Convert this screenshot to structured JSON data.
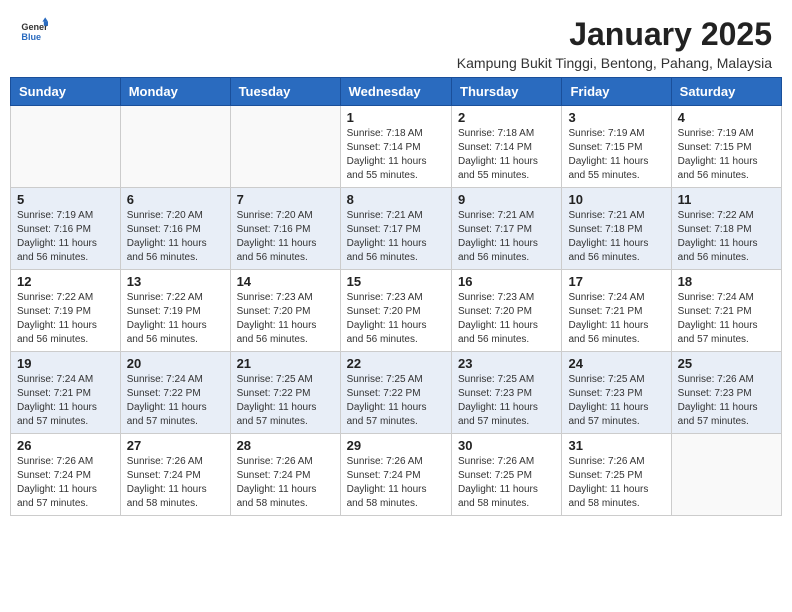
{
  "header": {
    "logo_general": "General",
    "logo_blue": "Blue",
    "month_year": "January 2025",
    "location": "Kampung Bukit Tinggi, Bentong, Pahang, Malaysia"
  },
  "days_of_week": [
    "Sunday",
    "Monday",
    "Tuesday",
    "Wednesday",
    "Thursday",
    "Friday",
    "Saturday"
  ],
  "weeks": [
    [
      {
        "day": "",
        "info": ""
      },
      {
        "day": "",
        "info": ""
      },
      {
        "day": "",
        "info": ""
      },
      {
        "day": "1",
        "info": "Sunrise: 7:18 AM\nSunset: 7:14 PM\nDaylight: 11 hours\nand 55 minutes."
      },
      {
        "day": "2",
        "info": "Sunrise: 7:18 AM\nSunset: 7:14 PM\nDaylight: 11 hours\nand 55 minutes."
      },
      {
        "day": "3",
        "info": "Sunrise: 7:19 AM\nSunset: 7:15 PM\nDaylight: 11 hours\nand 55 minutes."
      },
      {
        "day": "4",
        "info": "Sunrise: 7:19 AM\nSunset: 7:15 PM\nDaylight: 11 hours\nand 56 minutes."
      }
    ],
    [
      {
        "day": "5",
        "info": "Sunrise: 7:19 AM\nSunset: 7:16 PM\nDaylight: 11 hours\nand 56 minutes."
      },
      {
        "day": "6",
        "info": "Sunrise: 7:20 AM\nSunset: 7:16 PM\nDaylight: 11 hours\nand 56 minutes."
      },
      {
        "day": "7",
        "info": "Sunrise: 7:20 AM\nSunset: 7:16 PM\nDaylight: 11 hours\nand 56 minutes."
      },
      {
        "day": "8",
        "info": "Sunrise: 7:21 AM\nSunset: 7:17 PM\nDaylight: 11 hours\nand 56 minutes."
      },
      {
        "day": "9",
        "info": "Sunrise: 7:21 AM\nSunset: 7:17 PM\nDaylight: 11 hours\nand 56 minutes."
      },
      {
        "day": "10",
        "info": "Sunrise: 7:21 AM\nSunset: 7:18 PM\nDaylight: 11 hours\nand 56 minutes."
      },
      {
        "day": "11",
        "info": "Sunrise: 7:22 AM\nSunset: 7:18 PM\nDaylight: 11 hours\nand 56 minutes."
      }
    ],
    [
      {
        "day": "12",
        "info": "Sunrise: 7:22 AM\nSunset: 7:19 PM\nDaylight: 11 hours\nand 56 minutes."
      },
      {
        "day": "13",
        "info": "Sunrise: 7:22 AM\nSunset: 7:19 PM\nDaylight: 11 hours\nand 56 minutes."
      },
      {
        "day": "14",
        "info": "Sunrise: 7:23 AM\nSunset: 7:20 PM\nDaylight: 11 hours\nand 56 minutes."
      },
      {
        "day": "15",
        "info": "Sunrise: 7:23 AM\nSunset: 7:20 PM\nDaylight: 11 hours\nand 56 minutes."
      },
      {
        "day": "16",
        "info": "Sunrise: 7:23 AM\nSunset: 7:20 PM\nDaylight: 11 hours\nand 56 minutes."
      },
      {
        "day": "17",
        "info": "Sunrise: 7:24 AM\nSunset: 7:21 PM\nDaylight: 11 hours\nand 56 minutes."
      },
      {
        "day": "18",
        "info": "Sunrise: 7:24 AM\nSunset: 7:21 PM\nDaylight: 11 hours\nand 57 minutes."
      }
    ],
    [
      {
        "day": "19",
        "info": "Sunrise: 7:24 AM\nSunset: 7:21 PM\nDaylight: 11 hours\nand 57 minutes."
      },
      {
        "day": "20",
        "info": "Sunrise: 7:24 AM\nSunset: 7:22 PM\nDaylight: 11 hours\nand 57 minutes."
      },
      {
        "day": "21",
        "info": "Sunrise: 7:25 AM\nSunset: 7:22 PM\nDaylight: 11 hours\nand 57 minutes."
      },
      {
        "day": "22",
        "info": "Sunrise: 7:25 AM\nSunset: 7:22 PM\nDaylight: 11 hours\nand 57 minutes."
      },
      {
        "day": "23",
        "info": "Sunrise: 7:25 AM\nSunset: 7:23 PM\nDaylight: 11 hours\nand 57 minutes."
      },
      {
        "day": "24",
        "info": "Sunrise: 7:25 AM\nSunset: 7:23 PM\nDaylight: 11 hours\nand 57 minutes."
      },
      {
        "day": "25",
        "info": "Sunrise: 7:26 AM\nSunset: 7:23 PM\nDaylight: 11 hours\nand 57 minutes."
      }
    ],
    [
      {
        "day": "26",
        "info": "Sunrise: 7:26 AM\nSunset: 7:24 PM\nDaylight: 11 hours\nand 57 minutes."
      },
      {
        "day": "27",
        "info": "Sunrise: 7:26 AM\nSunset: 7:24 PM\nDaylight: 11 hours\nand 58 minutes."
      },
      {
        "day": "28",
        "info": "Sunrise: 7:26 AM\nSunset: 7:24 PM\nDaylight: 11 hours\nand 58 minutes."
      },
      {
        "day": "29",
        "info": "Sunrise: 7:26 AM\nSunset: 7:24 PM\nDaylight: 11 hours\nand 58 minutes."
      },
      {
        "day": "30",
        "info": "Sunrise: 7:26 AM\nSunset: 7:25 PM\nDaylight: 11 hours\nand 58 minutes."
      },
      {
        "day": "31",
        "info": "Sunrise: 7:26 AM\nSunset: 7:25 PM\nDaylight: 11 hours\nand 58 minutes."
      },
      {
        "day": "",
        "info": ""
      }
    ]
  ]
}
